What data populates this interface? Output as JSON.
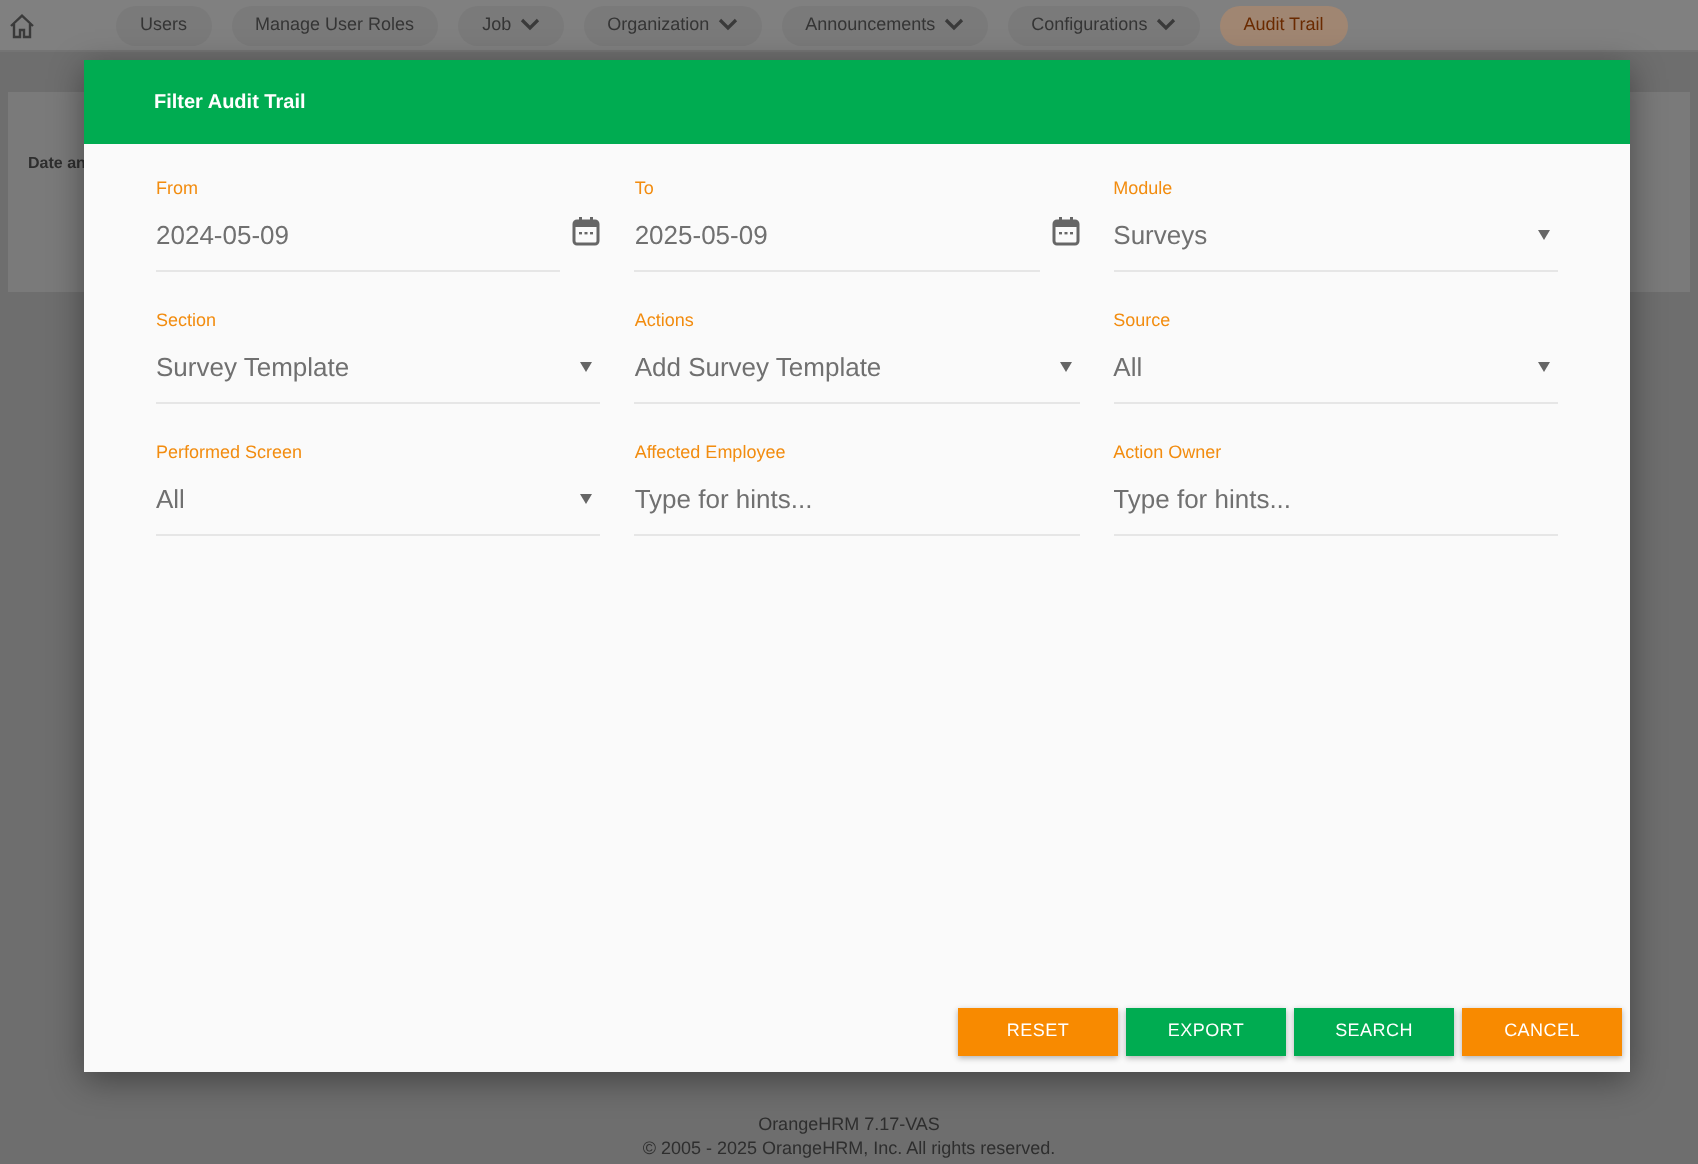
{
  "nav": {
    "items": [
      {
        "label": "Users",
        "has_menu": false,
        "selected": false
      },
      {
        "label": "Manage User Roles",
        "has_menu": false,
        "selected": false
      },
      {
        "label": "Job",
        "has_menu": true,
        "selected": false
      },
      {
        "label": "Organization",
        "has_menu": true,
        "selected": false
      },
      {
        "label": "Announcements",
        "has_menu": true,
        "selected": false
      },
      {
        "label": "Configurations",
        "has_menu": true,
        "selected": false
      },
      {
        "label": "Audit Trail",
        "has_menu": false,
        "selected": true
      }
    ]
  },
  "background_table": {
    "column_1": "Date an"
  },
  "dialog": {
    "title": "Filter Audit Trail",
    "fields": [
      {
        "label": "From",
        "kind": "date",
        "value": "2024-05-09"
      },
      {
        "label": "To",
        "kind": "date",
        "value": "2025-05-09"
      },
      {
        "label": "Module",
        "kind": "select",
        "value": "Surveys"
      },
      {
        "label": "Section",
        "kind": "select",
        "value": "Survey Template"
      },
      {
        "label": "Actions",
        "kind": "select",
        "value": "Add Survey Template"
      },
      {
        "label": "Source",
        "kind": "select",
        "value": "All"
      },
      {
        "label": "Performed Screen",
        "kind": "select",
        "value": "All"
      },
      {
        "label": "Affected Employee",
        "kind": "text",
        "placeholder": "Type for hints..."
      },
      {
        "label": "Action Owner",
        "kind": "text",
        "placeholder": "Type for hints..."
      }
    ],
    "buttons": [
      {
        "label": "RESET",
        "kind": "secondary"
      },
      {
        "label": "EXPORT",
        "kind": "primary"
      },
      {
        "label": "SEARCH",
        "kind": "primary"
      },
      {
        "label": "CANCEL",
        "kind": "secondary"
      }
    ]
  },
  "footer": {
    "version": "OrangeHRM 7.17-VAS",
    "copyright": "© 2005 - 2025 OrangeHRM, Inc. All rights reserved."
  }
}
